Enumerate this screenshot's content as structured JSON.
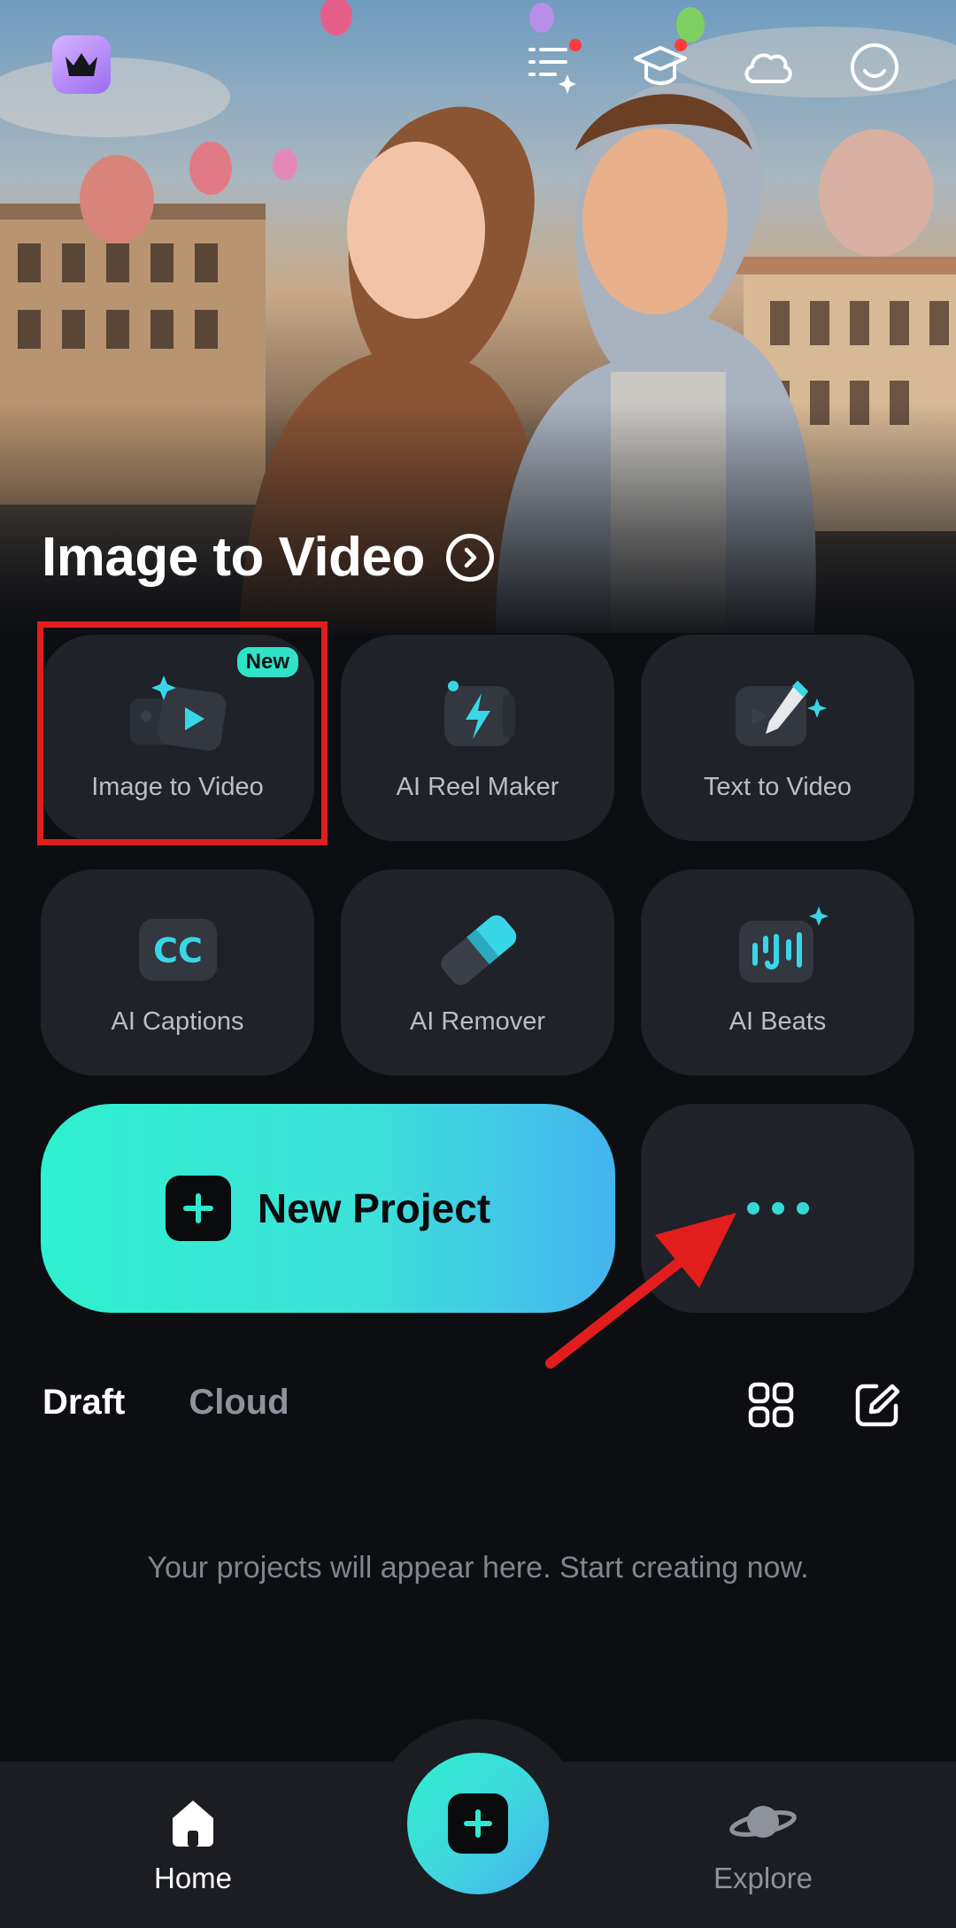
{
  "hero": {
    "title": "Image to Video",
    "arrow_icon": "chevron-right-circle-icon"
  },
  "top_bar": {
    "icons": [
      "crown-icon",
      "task-list-icon",
      "graduation-cap-icon",
      "cloud-icon",
      "smiley-icon"
    ]
  },
  "tools": [
    {
      "label": "Image to Video",
      "icon": "image-to-video-icon",
      "badge": "New"
    },
    {
      "label": "AI Reel Maker",
      "icon": "lightning-icon"
    },
    {
      "label": "Text to Video",
      "icon": "pencil-video-icon"
    },
    {
      "label": "AI Captions",
      "icon": "cc-icon"
    },
    {
      "label": "AI Remover",
      "icon": "eraser-icon"
    },
    {
      "label": "AI Beats",
      "icon": "music-beats-icon"
    }
  ],
  "new_project": {
    "label": "New Project"
  },
  "more": {
    "icon": "more-dots-icon"
  },
  "tabs": {
    "draft": "Draft",
    "cloud": "Cloud"
  },
  "empty_state": {
    "message": "Your projects will appear here. Start creating now."
  },
  "bottom_nav": {
    "home": "Home",
    "explore": "Explore"
  },
  "colors": {
    "accent": "#2ff0cf",
    "accent_blue": "#45b4ef",
    "highlight": "#e21d1d",
    "tile_bg": "#1f2228"
  }
}
